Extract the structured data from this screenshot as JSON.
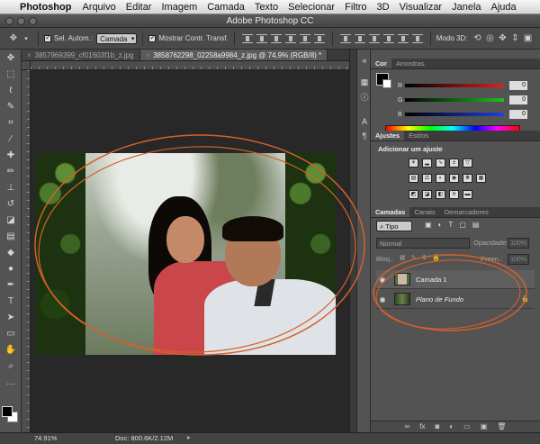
{
  "menubar": {
    "app_name": "Photoshop",
    "items": [
      "Arquivo",
      "Editar",
      "Imagem",
      "Camada",
      "Texto",
      "Selecionar",
      "Filtro",
      "3D",
      "Visualizar",
      "Janela",
      "Ajuda"
    ]
  },
  "window": {
    "title": "Adobe Photoshop CC"
  },
  "options": {
    "auto_select_label": "Sel. Autom.:",
    "auto_select_value": "Camada",
    "show_transform_label": "Mostrar Contr. Transf.",
    "mode3d_label": "Modo 3D:"
  },
  "doc_tabs": [
    {
      "label": "3857969399_cf01603f1b_z.jpg",
      "active": false
    },
    {
      "label": "3858762298_02258a9984_z.jpg @ 74,9% (RGB/8) *",
      "active": true
    }
  ],
  "color_panel": {
    "tabs": [
      "Cor",
      "Amostras"
    ],
    "sliders": [
      {
        "label": "R",
        "value": "0",
        "color": "#e02020"
      },
      {
        "label": "G",
        "value": "0",
        "color": "#20c020"
      },
      {
        "label": "B",
        "value": "0",
        "color": "#2040e0"
      }
    ]
  },
  "adjust_panel": {
    "tabs": [
      "Ajustes",
      "Estilos"
    ],
    "heading": "Adicionar um ajuste"
  },
  "layers_panel": {
    "tabs": [
      "Camadas",
      "Canais",
      "Demarcadores"
    ],
    "filter_label": "Tipo",
    "blend_mode": "Normal",
    "opacity_label": "Opacidade:",
    "opacity_value": "100%",
    "lock_label": "Bloq.:",
    "fill_label": "Preen.:",
    "fill_value": "100%",
    "layers": [
      {
        "name": "Camada 1"
      },
      {
        "name": "Plano de Fundo"
      }
    ]
  },
  "status": {
    "zoom": "74.91%",
    "doc_size": "Doc: 800.6K/2.12M"
  },
  "colors": {
    "annotation": "#d4612a"
  }
}
